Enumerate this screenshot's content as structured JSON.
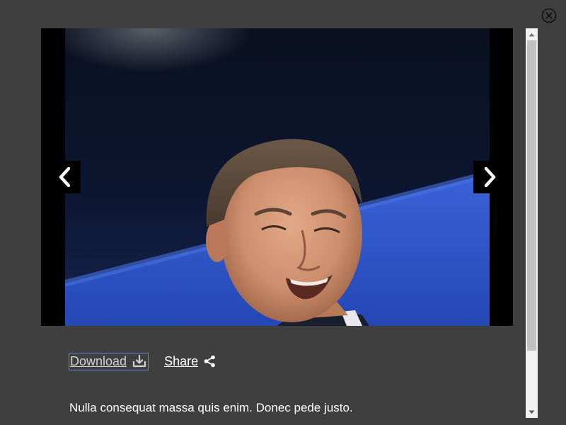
{
  "viewer": {
    "close_icon": "close-circle-icon",
    "prev_icon": "chevron-left-icon",
    "next_icon": "chevron-right-icon",
    "photo_description_colors": {
      "background_dark": "#0a1020",
      "stage_blue": "#2f56c9",
      "skin": "#c98d6e",
      "hair": "#5a4a3c"
    }
  },
  "actions": {
    "download_label": "Download",
    "download_icon": "download-tray-icon",
    "share_label": "Share",
    "share_icon": "share-icon"
  },
  "caption": "Nulla consequat massa quis enim. Donec pede justo."
}
